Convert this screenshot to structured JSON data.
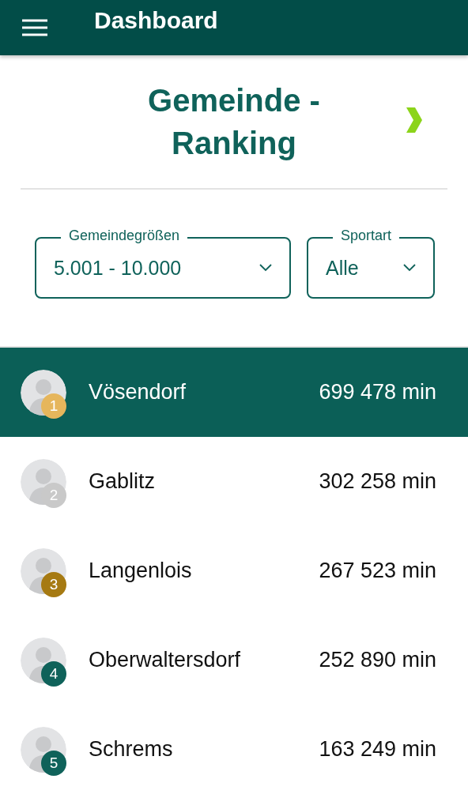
{
  "app_bar": {
    "title": "Dashboard"
  },
  "heading": {
    "title": "Gemeinde - Ranking"
  },
  "filters": [
    {
      "label": "Gemeindegrößen",
      "value": "5.001 - 10.000"
    },
    {
      "label": "Sportart",
      "value": "Alle"
    }
  ],
  "ranking": [
    {
      "rank": "1",
      "name": "Vösendorf",
      "value": "699 478 min",
      "selected": true,
      "color": "#e6b65c"
    },
    {
      "rank": "2",
      "name": "Gablitz",
      "value": "302 258 min",
      "selected": false,
      "color": "#c9c9c9"
    },
    {
      "rank": "3",
      "name": "Langenlois",
      "value": "267 523 min",
      "selected": false,
      "color": "#a67a12"
    },
    {
      "rank": "4",
      "name": "Oberwaltersdorf",
      "value": "252 890 min",
      "selected": false,
      "color": "#0f625a"
    },
    {
      "rank": "5",
      "name": "Schrems",
      "value": "163 249 min",
      "selected": false,
      "color": "#0f625a"
    }
  ]
}
